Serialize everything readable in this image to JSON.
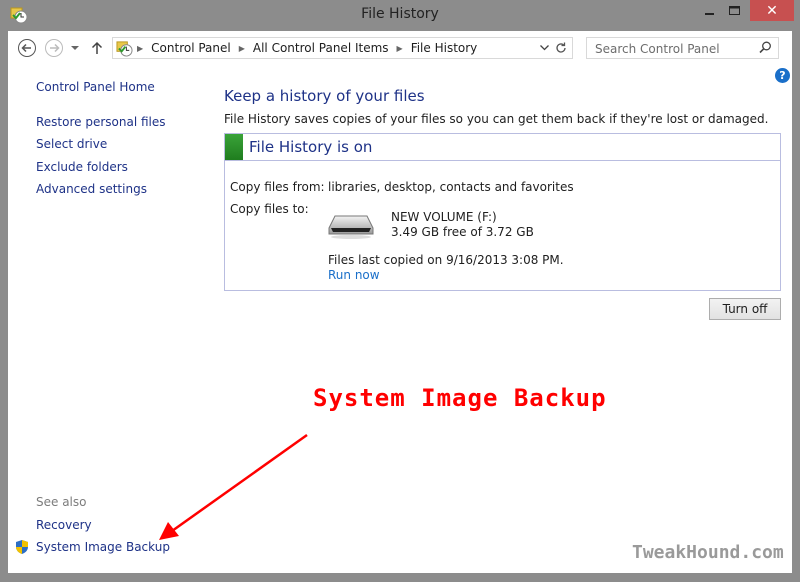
{
  "window": {
    "title": "File History",
    "app_icon": "file-history-icon",
    "controls": {
      "minimize": "–",
      "maximize": "□",
      "close": "✕"
    }
  },
  "navbar": {
    "back_icon": "back-arrow-icon",
    "forward_icon": "forward-arrow-icon",
    "recent_icon": "chevron-down-icon",
    "up_icon": "up-arrow-icon",
    "breadcrumb": [
      "Control Panel",
      "All Control Panel Items",
      "File History"
    ],
    "search_placeholder": "Search Control Panel"
  },
  "sidebar": {
    "home": "Control Panel Home",
    "items": [
      "Restore personal files",
      "Select drive",
      "Exclude folders",
      "Advanced settings"
    ],
    "see_also_label": "See also",
    "see_also": [
      "Recovery",
      "System Image Backup"
    ]
  },
  "main": {
    "heading": "Keep a history of your files",
    "description": "File History saves copies of your files so you can get them back if they're lost or damaged.",
    "status_title": "File History is on",
    "status_color": "#2e9a2d",
    "copy_from_label": "Copy files from:",
    "copy_from_value": "libraries, desktop, contacts and favorites",
    "copy_to_label": "Copy files to:",
    "drive_name": "NEW VOLUME (F:)",
    "drive_space": "3.49 GB free of 3.72 GB",
    "last_copied": "Files last copied on 9/16/2013 3:08 PM.",
    "run_now": "Run now",
    "turn_off": "Turn off"
  },
  "annotation": {
    "text": "System Image Backup",
    "color": "#ff0000"
  },
  "watermark": "TweakHound.com"
}
